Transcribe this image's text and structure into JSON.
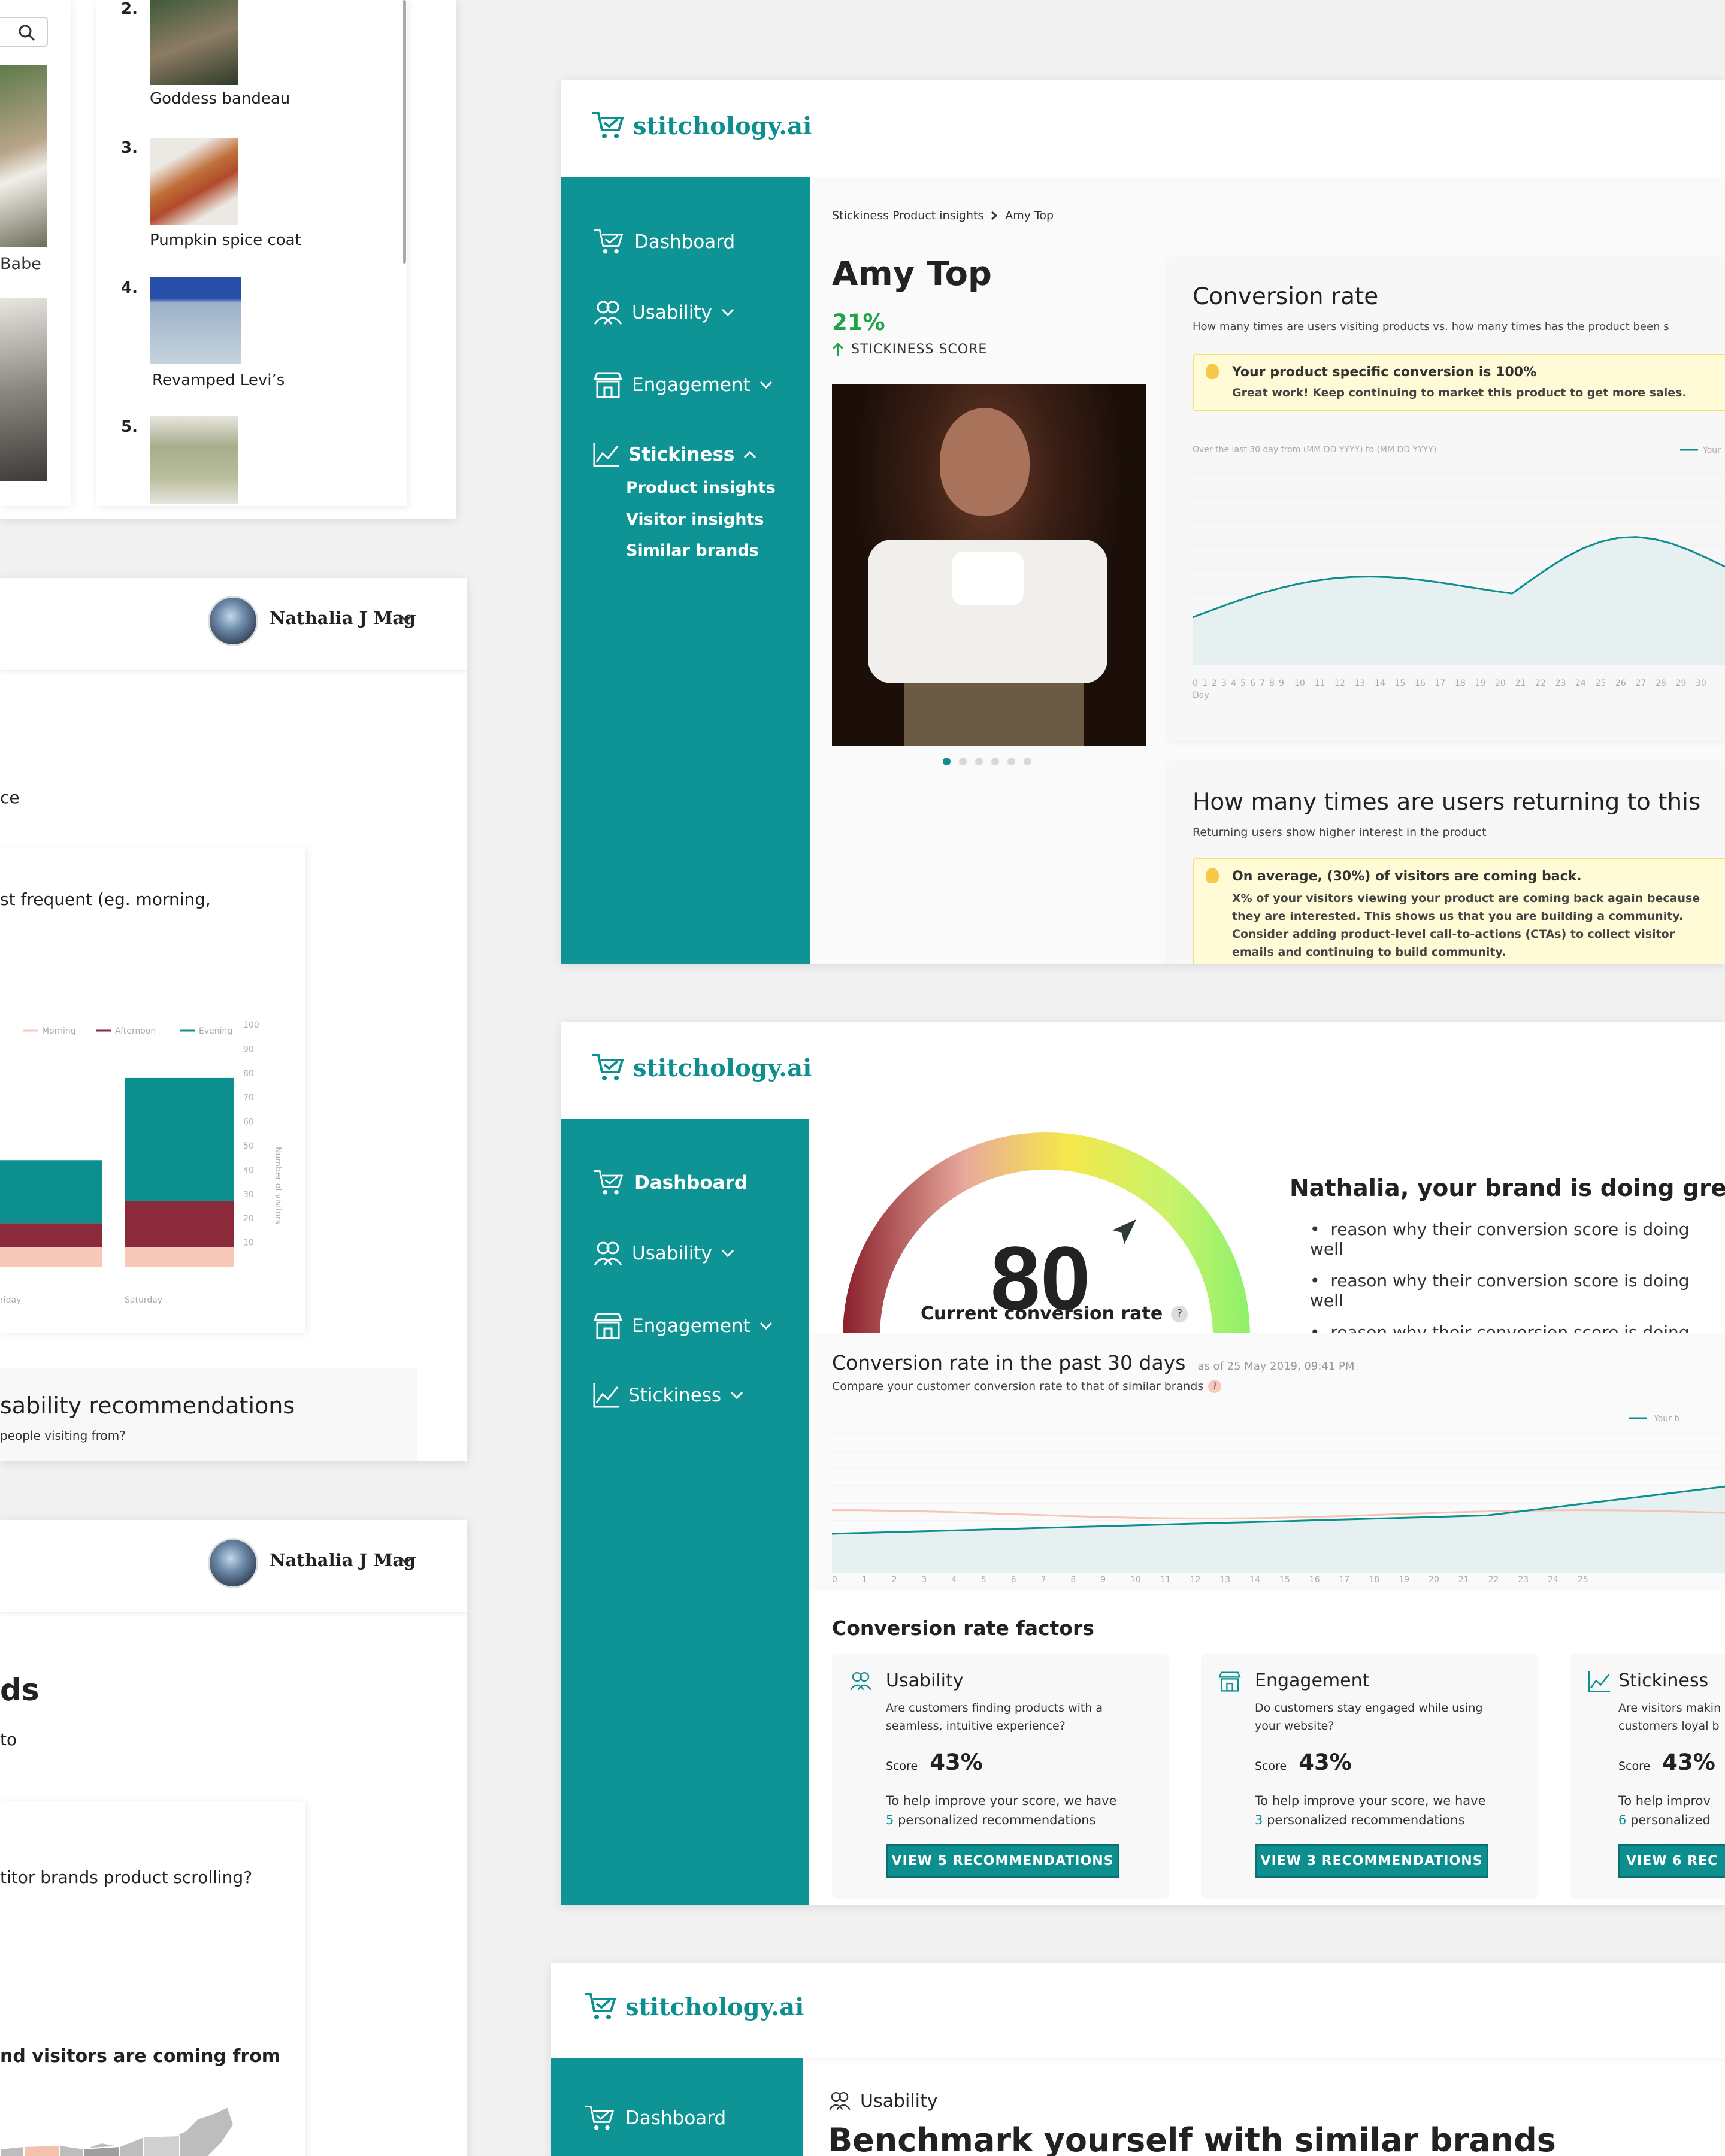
{
  "top_list": {
    "items": [
      {
        "rank": "2.",
        "name": "Goddess bandeau"
      },
      {
        "rank": "3.",
        "name": "Pumpkin spice coat"
      },
      {
        "rank": "4.",
        "name": "Revamped Levi’s"
      },
      {
        "rank": "5.",
        "name": ""
      }
    ],
    "left_partial_label": "Babe"
  },
  "user": {
    "name": "Nathalia J Mag"
  },
  "left_panel_mid": {
    "fragment_1": "ce",
    "question_fragment": "st frequent (eg. morning,",
    "legend": [
      "Morning",
      "Afternoon",
      "Evening"
    ],
    "y_ticks": [
      "100",
      "90",
      "80",
      "70",
      "60",
      "50",
      "40",
      "30",
      "20",
      "10"
    ],
    "y_axis_label": "Number of visitors",
    "x_labels": [
      "riday",
      "Saturday"
    ],
    "bars": [
      {
        "label": "riday",
        "morning": 8,
        "afternoon": 10,
        "evening": 26
      },
      {
        "label": "Saturday",
        "morning": 8,
        "afternoon": 19,
        "evening": 51
      }
    ],
    "recommendations_title": "sability recommendations",
    "recommendations_sub": "people visiting from?"
  },
  "left_panel_low": {
    "heading_fragment": "ds",
    "sub_fragment": "to",
    "question": "titor brands product scrolling?",
    "map_title": "nd visitors are coming from"
  },
  "brand": {
    "name": "stitchology.ai"
  },
  "nav": {
    "dashboard": "Dashboard",
    "usability": "Usability",
    "engagement": "Engagement",
    "stickiness": "Stickiness",
    "stickiness_sub": [
      "Product insights",
      "Visitor insights",
      "Similar brands"
    ]
  },
  "product": {
    "breadcrumb_root": "Stickiness Product insights",
    "breadcrumb_leaf": "Amy Top",
    "title": "Amy Top",
    "score": "21%",
    "score_label": "STICKINESS SCORE",
    "conversion_title": "Conversion rate",
    "conversion_sub": "How many times are users visiting products vs. how many times has the product been s",
    "tip_title": "Your product specific conversion is 100%",
    "tip_body": "Great work! Keep continuing to market this product to get more sales.",
    "chart_range": "Over the last 30 day from (MM DD YYYY) to (MM DD YYYY)",
    "chart_legend": "Your",
    "x_label": "Day",
    "returning_title": "How many times are users returning to this",
    "returning_sub": "Returning users show higher interest in the product",
    "returning_tip_title": "On average, (30%) of visitors are coming back.",
    "returning_tip_body": "X% of your visitors viewing your product are coming back again because they are interested. This shows us that you are building a community. Consider adding product-level call-to-actions (CTAs) to collect visitor emails and continuing to build community."
  },
  "dashboard": {
    "gauge_value": "80",
    "gauge_label": "Current conversion rate",
    "headline": "Nathalia, your brand is doing great!",
    "reasons": [
      "reason why their conversion score is doing well",
      "reason why their conversion score is doing well",
      "reason why their conversion score is doing well"
    ],
    "chart_title": "Conversion rate in the past 30 days",
    "chart_asof": "as of 25 May 2019, 09:41 PM",
    "chart_sub": "Compare your customer conversion rate to that of similar brands",
    "chart_legend": "Your b",
    "factors_title": "Conversion rate factors",
    "factors": [
      {
        "name": "Usability",
        "desc": "Are customers finding products with a seamless, intuitive experience?",
        "score_label": "Score",
        "score": "43%",
        "help": "To help improve your score, we have",
        "count": "5",
        "help2": "personalized recommendations",
        "button": "VIEW 5 RECOMMENDATIONS"
      },
      {
        "name": "Engagement",
        "desc": "Do customers stay engaged while using your website?",
        "score_label": "Score",
        "score": "43%",
        "help": "To help improve your score, we have",
        "count": "3",
        "help2": "personalized recommendations",
        "button": "VIEW 3 RECOMMENDATIONS"
      },
      {
        "name": "Stickiness",
        "desc": "Are visitors makin customers loyal b",
        "score_label": "Score",
        "score": "43%",
        "help": "To help improv",
        "count": "6",
        "help2": "personalized",
        "button": "VIEW 6 REC"
      }
    ]
  },
  "usability_page": {
    "section": "Usability",
    "title": "Benchmark yourself with similar brands"
  },
  "colors": {
    "accent": "#0e9494",
    "accent_dark": "#0b7070",
    "green_score": "#1fa34a"
  }
}
